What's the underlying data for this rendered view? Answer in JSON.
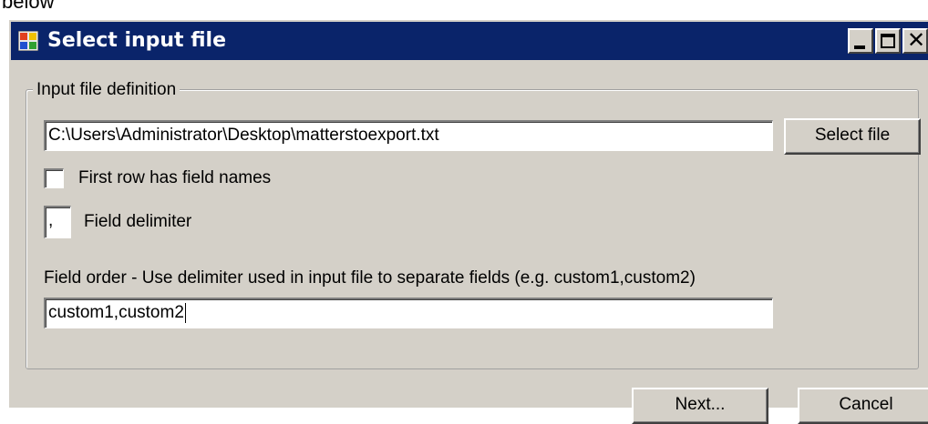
{
  "above_text": "below",
  "window": {
    "title": "Select input file",
    "icon": "app-form-icon",
    "controls": {
      "minimize": "minimize-icon",
      "maximize": "maximize-icon",
      "close": "close-icon"
    }
  },
  "group": {
    "legend": "Input file definition"
  },
  "file": {
    "path_value": "C:\\Users\\Administrator\\Desktop\\matterstoexport.txt",
    "select_label": "Select file"
  },
  "first_row": {
    "label": "First row has field names",
    "checked": false
  },
  "delimiter": {
    "value": ",",
    "label": "Field delimiter"
  },
  "field_order": {
    "label": "Field order - Use delimiter used in input file to separate fields (e.g. custom1,custom2)",
    "value": "custom1,custom2"
  },
  "footer": {
    "next_label": "Next...",
    "cancel_label": "Cancel"
  },
  "colors": {
    "titlebar": "#0a246a",
    "face": "#d4d0c8"
  }
}
